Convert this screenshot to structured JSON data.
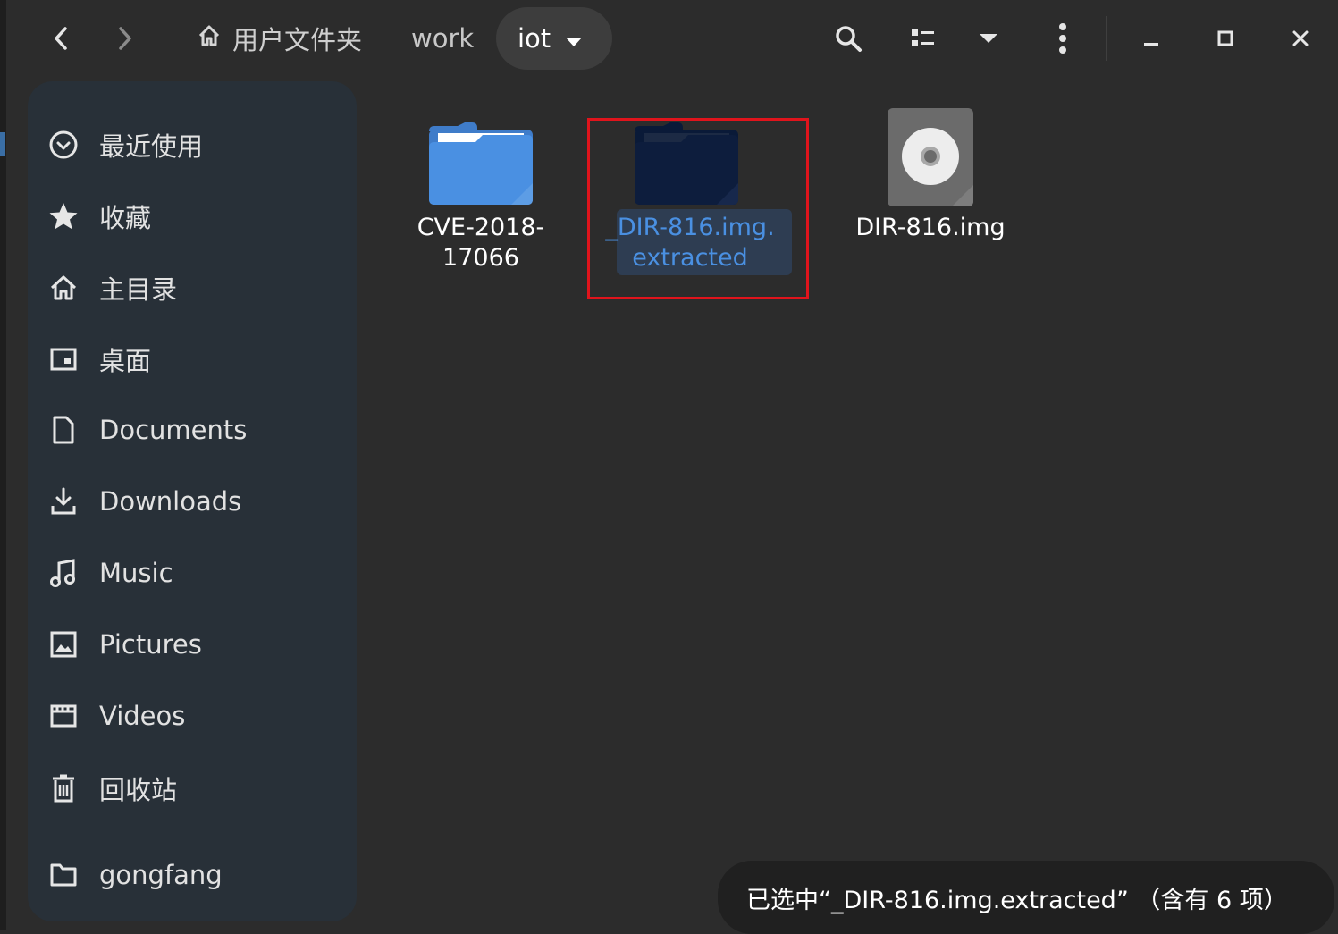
{
  "window": {
    "nav_back_icon": "chevron-left-icon",
    "nav_forward_icon": "chevron-right-icon"
  },
  "breadcrumb": {
    "home_label": "用户文件夹",
    "work_label": "work",
    "current_label": "iot"
  },
  "toolbar": {
    "search_icon": "search-icon",
    "view_icon": "list-view-icon",
    "view_menu_icon": "chevron-down-icon",
    "menu_icon": "kebab-menu-icon",
    "minimize_icon": "minimize-icon",
    "maximize_icon": "maximize-icon",
    "close_icon": "close-icon"
  },
  "sidebar": {
    "items": [
      {
        "label": "最近使用",
        "icon": "clock-icon"
      },
      {
        "label": "收藏",
        "icon": "star-icon"
      },
      {
        "label": "主目录",
        "icon": "home-icon"
      },
      {
        "label": "桌面",
        "icon": "desktop-icon"
      },
      {
        "label": "Documents",
        "icon": "document-icon"
      },
      {
        "label": "Downloads",
        "icon": "download-icon"
      },
      {
        "label": "Music",
        "icon": "music-icon"
      },
      {
        "label": "Pictures",
        "icon": "picture-icon"
      },
      {
        "label": "Videos",
        "icon": "video-icon"
      },
      {
        "label": "回收站",
        "icon": "trash-icon"
      },
      {
        "label": "gongfang",
        "icon": "folder-icon"
      }
    ]
  },
  "files": [
    {
      "line1": "CVE-2018-",
      "line2": "17066",
      "type": "folder",
      "selected": false
    },
    {
      "line1": "_DIR-816.img.",
      "line2": "extracted",
      "type": "folder",
      "selected": true
    },
    {
      "line1": "DIR-816.img",
      "line2": "",
      "type": "disk-image",
      "selected": false
    }
  ],
  "status": {
    "text": "已选中“_DIR-816.img.extracted” （含有 6 项）"
  },
  "colors": {
    "background": "#2c2c2c",
    "sidebar": "#283038",
    "folder_blue": "#4a90e2",
    "folder_selected": "#0d1d3d",
    "selection_text": "#4a90e2",
    "highlight_outline": "#e0141c"
  }
}
